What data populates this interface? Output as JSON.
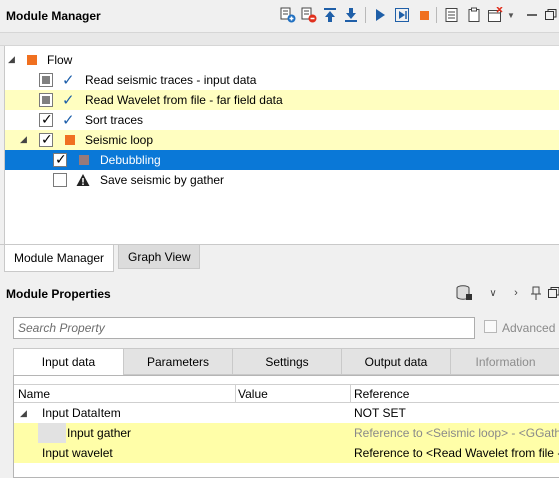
{
  "module_manager": {
    "title": "Module Manager",
    "toolbar": [
      "add-module-icon",
      "remove-module-icon",
      "move-up-icon",
      "move-down-icon",
      "run-icon",
      "run-step-icon",
      "stop-icon",
      "list-icon",
      "clipboard-icon",
      "window-options-icon",
      "minimize-icon",
      "restore-icon"
    ],
    "tree": {
      "root": "Flow",
      "items": [
        {
          "label": "Read seismic traces - input data",
          "highlighted": false
        },
        {
          "label": "Read Wavelet from file - far field data",
          "highlighted": true
        },
        {
          "label": "Sort traces",
          "highlighted": false
        },
        {
          "label": "Seismic loop",
          "highlighted": true
        },
        {
          "label": "Debubbling",
          "selected": true
        },
        {
          "label": "Save seismic by gather",
          "warning": true
        }
      ]
    },
    "bottom_tabs": [
      "Module Manager",
      "Graph View"
    ]
  },
  "module_properties": {
    "title": "Module Properties",
    "search_placeholder": "Search Property",
    "advanced_label": "Advanced",
    "tabs": [
      "Input data",
      "Parameters",
      "Settings",
      "Output data",
      "Information"
    ],
    "grid": {
      "columns": [
        "Name",
        "Value",
        "Reference"
      ],
      "rows": [
        {
          "name": "Input DataItem",
          "value": "",
          "reference": "NOT SET"
        },
        {
          "name": "Input gather",
          "value": "",
          "reference": "Reference to <Seismic loop> - <GGather"
        },
        {
          "name": "Input wavelet",
          "value": "",
          "reference": "Reference to <Read Wavelet from file -"
        }
      ]
    }
  },
  "colors": {
    "accent_blue": "#0a78d7",
    "orange": "#f07020",
    "highlight_yellow": "#fffec0",
    "check_blue": "#1d5fa9"
  }
}
